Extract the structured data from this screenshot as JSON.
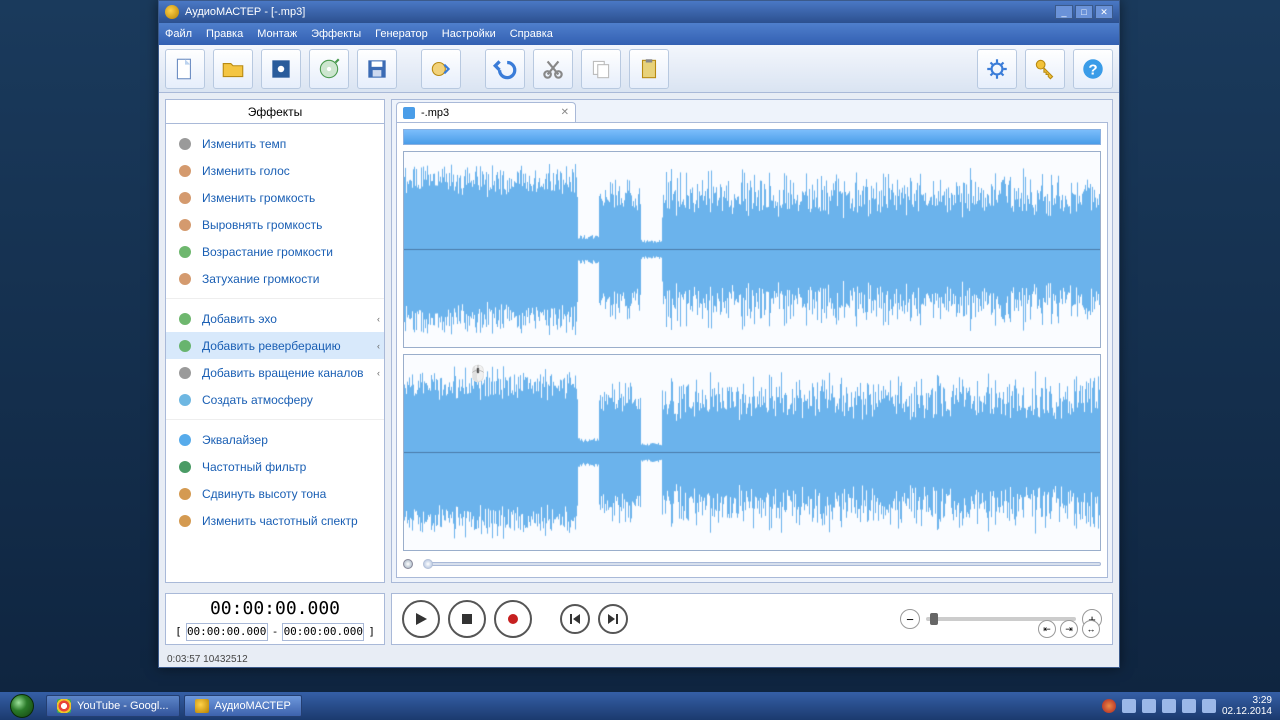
{
  "window": {
    "title": "АудиоМАСТЕР - [-.mp3]"
  },
  "menu": [
    "Файл",
    "Правка",
    "Монтаж",
    "Эффекты",
    "Генератор",
    "Настройки",
    "Справка"
  ],
  "sidebar": {
    "header": "Эффекты",
    "groups": [
      {
        "items": [
          {
            "label": "Изменить темп",
            "icon": "clock-icon",
            "active": false,
            "arrow": false
          },
          {
            "label": "Изменить голос",
            "icon": "voice-icon",
            "active": false,
            "arrow": false
          },
          {
            "label": "Изменить громкость",
            "icon": "volume-icon",
            "active": false,
            "arrow": false
          },
          {
            "label": "Выровнять громкость",
            "icon": "level-icon",
            "active": false,
            "arrow": false
          },
          {
            "label": "Возрастание громкости",
            "icon": "fadein-icon",
            "active": false,
            "arrow": false
          },
          {
            "label": "Затухание громкости",
            "icon": "fadeout-icon",
            "active": false,
            "arrow": false
          }
        ]
      },
      {
        "items": [
          {
            "label": "Добавить эхо",
            "icon": "echo-icon",
            "active": false,
            "arrow": true
          },
          {
            "label": "Добавить реверберацию",
            "icon": "reverb-icon",
            "active": true,
            "arrow": true
          },
          {
            "label": "Добавить вращение каналов",
            "icon": "rotate-icon",
            "active": false,
            "arrow": true
          },
          {
            "label": "Создать атмосферу",
            "icon": "atmos-icon",
            "active": false,
            "arrow": false
          }
        ]
      },
      {
        "items": [
          {
            "label": "Эквалайзер",
            "icon": "eq-icon",
            "active": false,
            "arrow": false
          },
          {
            "label": "Частотный фильтр",
            "icon": "filter-icon",
            "active": false,
            "arrow": false
          },
          {
            "label": "Сдвинуть высоту тона",
            "icon": "pitch-icon",
            "active": false,
            "arrow": false
          },
          {
            "label": "Изменить частотный спектр",
            "icon": "spectrum-icon",
            "active": false,
            "arrow": false
          }
        ]
      }
    ]
  },
  "tab": {
    "name": "-.mp3"
  },
  "time": {
    "current": "00:00:00.000",
    "from": "00:00:00.000",
    "to": "00:00:00.000",
    "sep": "-",
    "lb": "[",
    "rb": "]"
  },
  "status": "0:03:57 10432512",
  "taskbar": {
    "items": [
      {
        "label": "YouTube - Googl...",
        "active": false
      },
      {
        "label": "АудиоМАСТЕР",
        "active": true
      }
    ],
    "clock": {
      "time": "3:29",
      "date": "02.12.2014"
    }
  },
  "toolbarIcons": [
    "new",
    "open",
    "videoimport",
    "cdimport",
    "save",
    "capture",
    "undo",
    "cut",
    "copy",
    "paste",
    "settings",
    "key",
    "help"
  ]
}
